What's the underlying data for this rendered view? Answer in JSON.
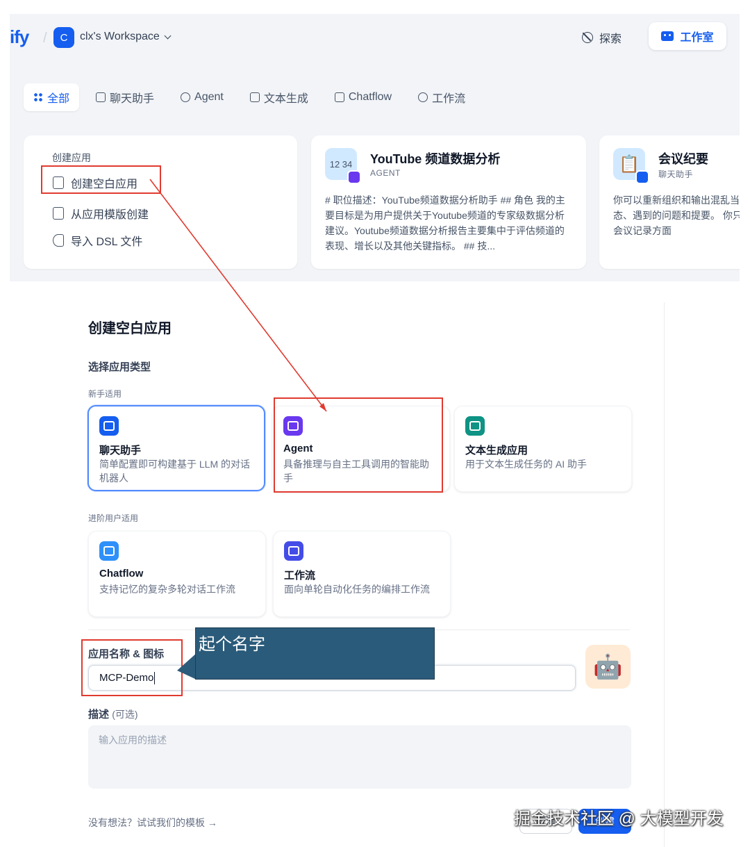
{
  "header": {
    "logo_text": "ify",
    "workspace_initial": "C",
    "workspace_name": "clx's Workspace",
    "explore_label": "探索",
    "studio_label": "工作室"
  },
  "filters": [
    {
      "label": "全部",
      "active": true,
      "icon": "grid-icon"
    },
    {
      "label": "聊天助手",
      "active": false,
      "icon": "chat-icon"
    },
    {
      "label": "Agent",
      "active": false,
      "icon": "agent-icon"
    },
    {
      "label": "文本生成",
      "active": false,
      "icon": "text-icon"
    },
    {
      "label": "Chatflow",
      "active": false,
      "icon": "chatflow-icon"
    },
    {
      "label": "工作流",
      "active": false,
      "icon": "workflow-icon"
    }
  ],
  "create_app": {
    "title": "创建应用",
    "items": [
      "创建空白应用",
      "从应用模版创建",
      "导入 DSL 文件"
    ]
  },
  "templates": [
    {
      "icon_text": "12 34",
      "name": "YouTube 频道数据分析",
      "type": "AGENT",
      "desc": "# 职位描述：YouTube频道数据分析助手 ## 角色 我的主要目标是为用户提供关于Youtube频道的专家级数据分析建议。Youtube频道数据分析报告主要集中于评估频道的表现、增长以及其他关键指标。 ## 技..."
    },
    {
      "icon_text": "📋",
      "name": "会议纪要",
      "type": "聊天助手",
      "desc": "你可以重新组织和输出混乱当前状态、遇到的问题和提要。 你只负责会议记录方面"
    }
  ],
  "modal": {
    "title": "创建空白应用",
    "type_section": "选择应用类型",
    "beginner_label": "新手适用",
    "advanced_label": "进阶用户适用",
    "app_types": [
      {
        "name": "聊天助手",
        "desc": "简单配置即可构建基于 LLM 的对话机器人",
        "color": "#155eef",
        "selected": true
      },
      {
        "name": "Agent",
        "desc": "具备推理与自主工具调用的智能助手",
        "color": "#6938ef",
        "selected": false
      },
      {
        "name": "文本生成应用",
        "desc": "用于文本生成任务的 AI 助手",
        "color": "#0e9384",
        "selected": false
      },
      {
        "name": "Chatflow",
        "desc": "支持记忆的复杂多轮对话工作流",
        "color": "#2e90fa",
        "selected": false
      },
      {
        "name": "工作流",
        "desc": "面向单轮自动化任务的编排工作流",
        "color": "#444ce7",
        "selected": false
      }
    ],
    "name_label": "应用名称 & 图标",
    "name_value": "MCP-Demo",
    "app_icon": "🤖",
    "desc_label": "描述",
    "desc_optional": "(可选)",
    "desc_placeholder": "输入应用的描述",
    "template_link": "没有想法？试试我们的模板 →",
    "cancel_label": "取消",
    "create_label": "创建"
  },
  "annotations": {
    "callout_text": "起个名字",
    "watermark": "掘金技术社区 @ 大模型开发"
  },
  "colors": {
    "primary": "#155eef",
    "annotation_red": "#e03a2f",
    "callout_bg": "#2b5b7a"
  }
}
